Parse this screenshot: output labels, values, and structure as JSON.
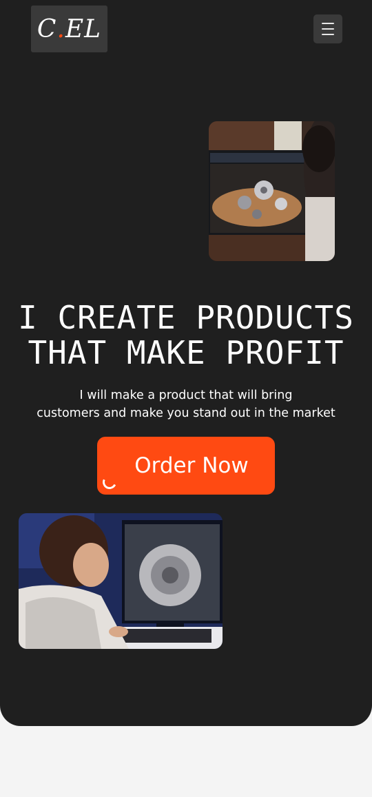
{
  "brand": {
    "logo_main": "C",
    "logo_dot": ".",
    "logo_tail": "EL"
  },
  "header": {
    "menu_icon": "hamburger-menu-icon"
  },
  "hero": {
    "headline_line1": "I CREATE PRODUCTS",
    "headline_line2": "THAT MAKE PROFIT",
    "subtext_line1": "I will make a product that will bring",
    "subtext_line2": "customers and make you stand out in the market",
    "cta_label": "Order Now",
    "images": [
      "cad-workstation-photo",
      "engineer-at-computer-photo"
    ]
  },
  "colors": {
    "background": "#1f1f1f",
    "accent": "#ff4a12",
    "page": "#f4f4f4"
  }
}
